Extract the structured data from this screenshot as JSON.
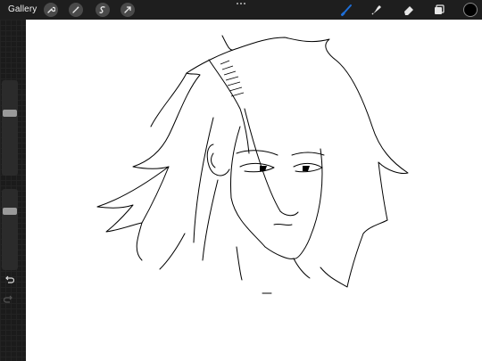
{
  "app": {
    "gallery_label": "Gallery"
  },
  "toolbar": {
    "left_tools": [
      "wrench-icon",
      "magic-wand-icon",
      "selection-icon",
      "transform-arrow-icon"
    ],
    "right_tools": [
      "brush-icon",
      "smudge-icon",
      "eraser-icon",
      "layers-icon"
    ],
    "active_tool": "brush-icon",
    "active_color": "#1e6fd9",
    "current_color": "#000000"
  },
  "sidebar": {
    "brush_size_level": 0.33,
    "opacity_level": 0.25,
    "buttons": [
      "modify-square-icon",
      "undo-icon",
      "redo-icon"
    ]
  },
  "canvas": {
    "background": "#ffffff",
    "stroke_color": "#000000"
  }
}
